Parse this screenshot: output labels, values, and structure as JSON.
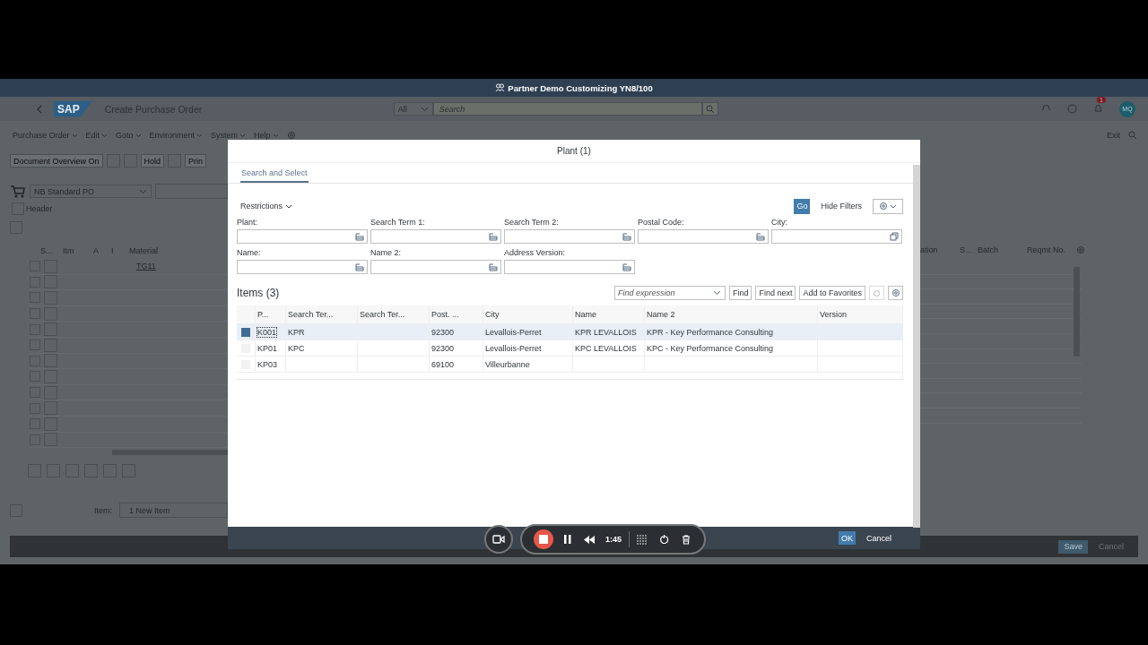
{
  "window": {
    "title": "Partner Demo Customizing YN8/100"
  },
  "shell": {
    "logo": "SAP",
    "app_title": "Create Purchase Order",
    "scope": "All",
    "search": {
      "placeholder": "Search"
    },
    "notification_count": "1",
    "avatar": "MQ"
  },
  "menu": [
    "Purchase Order",
    "Edit",
    "Goto",
    "Environment",
    "System",
    "Help"
  ],
  "menu_right": "Exit",
  "toolbar": [
    "Document Overview On",
    "Hold",
    "Prin"
  ],
  "order_type": "NB Standard PO",
  "header_label": "Header",
  "item_table": {
    "columns_left": [
      "S...",
      "Itm",
      "A",
      "I",
      "Material"
    ],
    "columns_right": [
      "ation",
      "S...",
      "Batch",
      "Reqmt No."
    ],
    "rows": [
      {
        "checked": false,
        "material": "TG11"
      },
      {
        "checked": false
      },
      {
        "checked": false
      },
      {
        "checked": false
      },
      {
        "checked": false
      },
      {
        "checked": false
      },
      {
        "checked": false
      },
      {
        "checked": false
      },
      {
        "checked": false
      },
      {
        "checked": false
      },
      {
        "checked": false
      },
      {
        "checked": false
      }
    ]
  },
  "item_field": {
    "label": "Item:",
    "value": "1 New Item"
  },
  "footer_buttons": [
    "Save",
    "Cancel"
  ],
  "dialog": {
    "title": "Plant (1)",
    "tabs": [
      {
        "label": "Search and Select",
        "selected": true
      }
    ],
    "restrictions": "Restrictions",
    "go": "Go",
    "hide_filters": "Hide Filters",
    "filters": [
      {
        "label": "Plant:",
        "kind": "list"
      },
      {
        "label": "Search Term 1:",
        "kind": "list"
      },
      {
        "label": "Search Term 2:",
        "kind": "list"
      },
      {
        "label": "Postal Code:",
        "kind": "list"
      },
      {
        "label": "City:",
        "kind": "dialog"
      },
      {
        "label": "Name:",
        "kind": "list"
      },
      {
        "label": "Name 2:",
        "kind": "list"
      },
      {
        "label": "Address Version:",
        "kind": "list"
      }
    ],
    "items_title": "Items (3)",
    "find": {
      "placeholder": "Find expression"
    },
    "buttons": [
      "Find",
      "Find next",
      "Add to Favorites"
    ],
    "table": {
      "columns": [
        "P...",
        "Search Ter...",
        "Search Ter...",
        "Post. ...",
        "City",
        "Name",
        "Name 2",
        "Version"
      ],
      "rows": [
        {
          "selected": true,
          "cells": [
            "K001",
            "KPR",
            "",
            "92300",
            "Levallois-Perret",
            "KPR LEVALLOIS",
            "KPR - Key Performance Consulting",
            ""
          ]
        },
        {
          "selected": false,
          "cells": [
            "KP01",
            "KPC",
            "",
            "92300",
            "Levallois-Perret",
            "KPC LEVALLOIS",
            "KPC - Key Performance Consulting",
            ""
          ]
        },
        {
          "selected": false,
          "cells": [
            "KP03",
            "",
            "",
            "69100",
            "Villeurbanne",
            "",
            "",
            ""
          ]
        }
      ]
    },
    "ok": "OK",
    "cancel": "Cancel"
  },
  "recorder": {
    "time": "1:45"
  }
}
